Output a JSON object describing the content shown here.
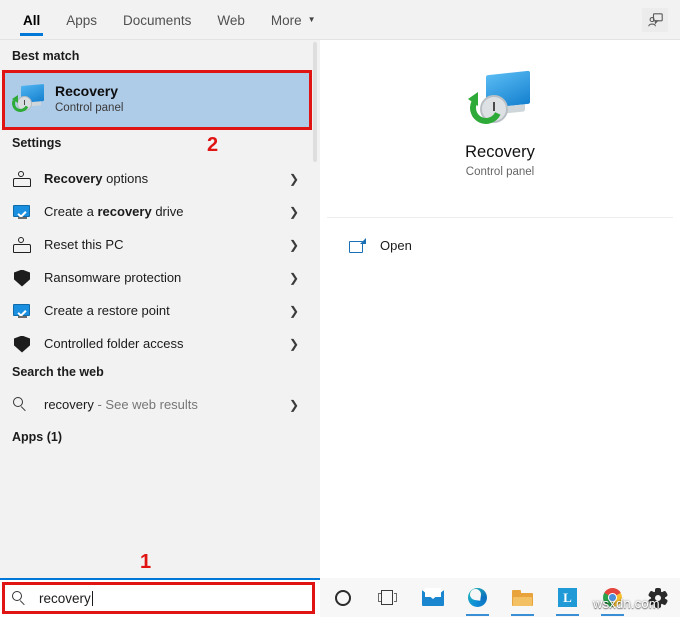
{
  "tabbar": {
    "tabs": [
      {
        "label": "All",
        "active": true
      },
      {
        "label": "Apps",
        "active": false
      },
      {
        "label": "Documents",
        "active": false
      },
      {
        "label": "Web",
        "active": false
      },
      {
        "label": "More",
        "active": false,
        "chevron": "▼"
      }
    ],
    "feedback_icon": "feedback-icon"
  },
  "results": {
    "best_match_header": "Best match",
    "best_match": {
      "title": "Recovery",
      "subtitle": "Control panel",
      "icon": "recovery-icon",
      "selected": true,
      "highlight_color": "#aecbe8"
    },
    "settings_header": "Settings",
    "settings_items": [
      {
        "prefix": "",
        "bold": "Recovery",
        "suffix": " options",
        "icon": "person-box-icon",
        "arrow": "❯"
      },
      {
        "prefix": "Create a ",
        "bold": "recovery",
        "suffix": " drive",
        "icon": "monitor-check-icon",
        "arrow": "❯"
      },
      {
        "prefix": "Reset this PC",
        "bold": "",
        "suffix": "",
        "icon": "person-box-icon",
        "arrow": "❯"
      },
      {
        "prefix": "Ransomware protection",
        "bold": "",
        "suffix": "",
        "icon": "shield-icon",
        "arrow": "❯"
      },
      {
        "prefix": "Create a restore point",
        "bold": "",
        "suffix": "",
        "icon": "monitor-check-icon",
        "arrow": "❯"
      },
      {
        "prefix": "Controlled folder access",
        "bold": "",
        "suffix": "",
        "icon": "shield-icon",
        "arrow": "❯"
      }
    ],
    "web_header": "Search the web",
    "web_item": {
      "query": "recovery",
      "suffix": " - See web results",
      "icon": "search-icon",
      "arrow": "❯"
    },
    "apps_header": "Apps (1)"
  },
  "preview": {
    "title": "Recovery",
    "subtitle": "Control panel",
    "icon": "recovery-icon",
    "actions": [
      {
        "label": "Open",
        "icon": "open-external-icon"
      }
    ]
  },
  "search": {
    "value": "recovery",
    "icon": "search-icon",
    "accent_color": "#0078d7"
  },
  "taskbar": {
    "items": [
      {
        "name": "cortana",
        "icon": "cortana-circle-icon",
        "active": false
      },
      {
        "name": "task-view",
        "icon": "task-view-icon",
        "active": false
      },
      {
        "name": "mail",
        "icon": "mail-icon",
        "active": false
      },
      {
        "name": "edge",
        "icon": "edge-icon",
        "active": true
      },
      {
        "name": "file-explorer",
        "icon": "folder-icon",
        "active": true
      },
      {
        "name": "l-app",
        "icon": "l-app-icon",
        "label": "L",
        "active": true
      },
      {
        "name": "chrome",
        "icon": "chrome-icon",
        "active": true
      },
      {
        "name": "settings",
        "icon": "gear-icon",
        "active": false
      }
    ]
  },
  "watermark": {
    "text": "wsxdn.com"
  },
  "annotations": {
    "step1": "1",
    "step2": "2",
    "color": "#e11414"
  }
}
